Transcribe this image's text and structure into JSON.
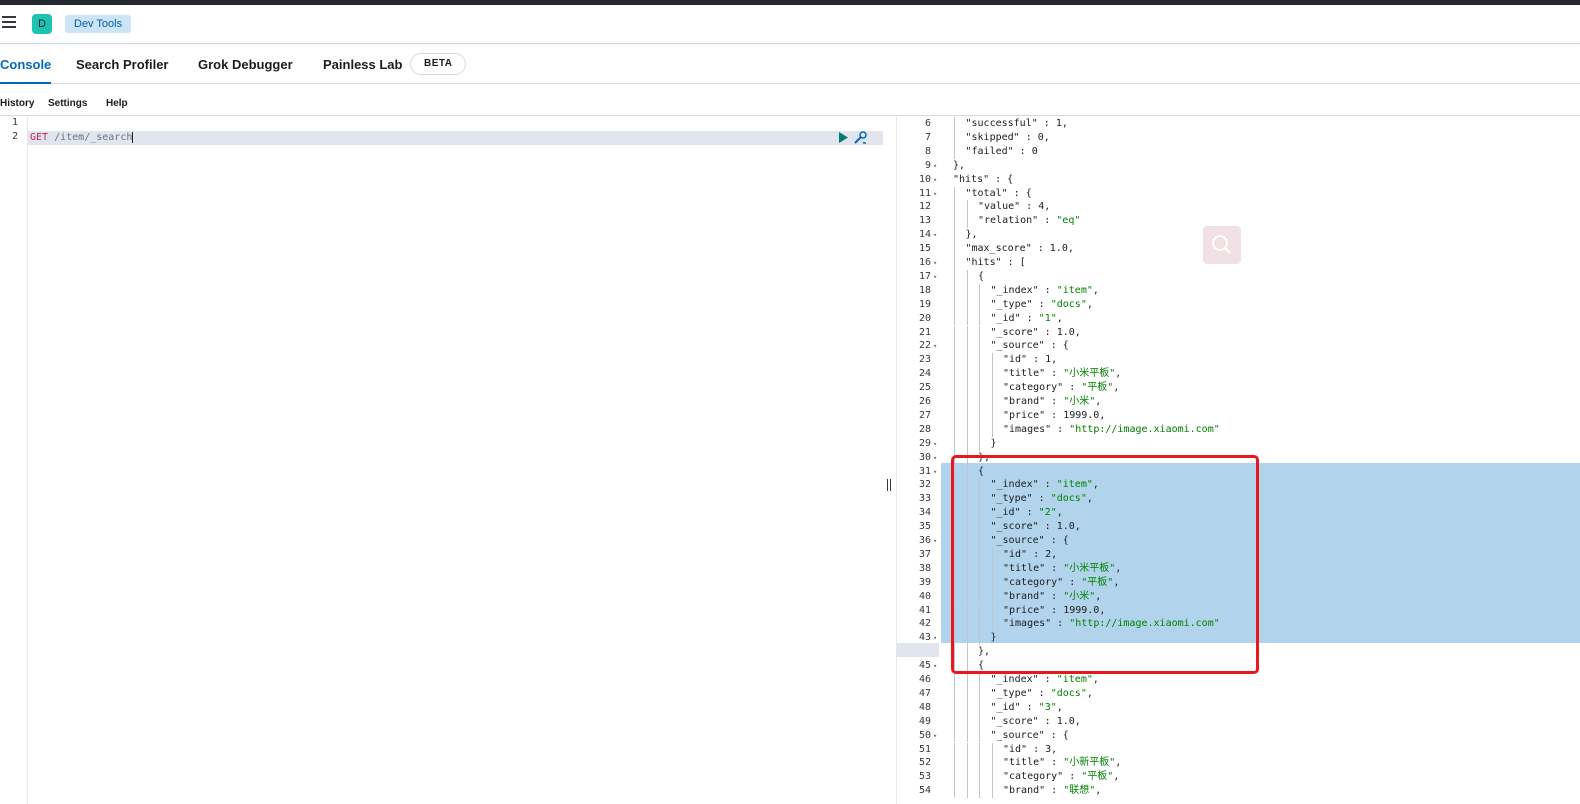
{
  "header": {
    "space_initial": "D",
    "breadcrumb": "Dev Tools"
  },
  "tabs": [
    {
      "label": "Console",
      "active": true
    },
    {
      "label": "Search Profiler",
      "active": false
    },
    {
      "label": "Grok Debugger",
      "active": false
    },
    {
      "label": "Painless Lab",
      "active": false
    }
  ],
  "beta_badge": "BETA",
  "subnav": {
    "history": "History",
    "settings": "Settings",
    "help": "Help"
  },
  "request": {
    "line_numbers": [
      "1",
      "2"
    ],
    "method": "GET",
    "path": "/item/_search"
  },
  "response": {
    "first_line_number": 6,
    "active_line_number": 44,
    "lines": [
      [
        2,
        [
          "k",
          "\"successful\" : "
        ],
        [
          "k",
          "1,"
        ]
      ],
      [
        2,
        [
          "k",
          "\"skipped\" : 0,"
        ]
      ],
      [
        2,
        [
          "k",
          "\"failed\" : 0"
        ]
      ],
      [
        1,
        [
          "k",
          "},"
        ]
      ],
      [
        1,
        [
          "k",
          "\"hits\" : {"
        ]
      ],
      [
        2,
        [
          "k",
          "\"total\" : {"
        ]
      ],
      [
        3,
        [
          "k",
          "\"value\" : 4,"
        ]
      ],
      [
        3,
        [
          "k",
          "\"relation\" : "
        ],
        [
          "s",
          "\"eq\""
        ]
      ],
      [
        2,
        [
          "k",
          "},"
        ]
      ],
      [
        2,
        [
          "k",
          "\"max_score\" : 1.0,"
        ]
      ],
      [
        2,
        [
          "k",
          "\"hits\" : ["
        ]
      ],
      [
        3,
        [
          "k",
          "{"
        ]
      ],
      [
        4,
        [
          "k",
          "\"_index\" : "
        ],
        [
          "s",
          "\"item\""
        ],
        [
          "k",
          ","
        ]
      ],
      [
        4,
        [
          "k",
          "\"_type\" : "
        ],
        [
          "s",
          "\"docs\""
        ],
        [
          "k",
          ","
        ]
      ],
      [
        4,
        [
          "k",
          "\"_id\" : "
        ],
        [
          "s",
          "\"1\""
        ],
        [
          "k",
          ","
        ]
      ],
      [
        4,
        [
          "k",
          "\"_score\" : 1.0,"
        ]
      ],
      [
        4,
        [
          "k",
          "\"_source\" : {"
        ]
      ],
      [
        5,
        [
          "k",
          "\"id\" : 1,"
        ]
      ],
      [
        5,
        [
          "k",
          "\"title\" : "
        ],
        [
          "s",
          "\"小米平板\""
        ],
        [
          "k",
          ","
        ]
      ],
      [
        5,
        [
          "k",
          "\"category\" : "
        ],
        [
          "s",
          "\"平板\""
        ],
        [
          "k",
          ","
        ]
      ],
      [
        5,
        [
          "k",
          "\"brand\" : "
        ],
        [
          "s",
          "\"小米\""
        ],
        [
          "k",
          ","
        ]
      ],
      [
        5,
        [
          "k",
          "\"price\" : 1999.0,"
        ]
      ],
      [
        5,
        [
          "k",
          "\"images\" : "
        ],
        [
          "s",
          "\"http://image.xiaomi.com\""
        ]
      ],
      [
        4,
        [
          "k",
          "}"
        ]
      ],
      [
        3,
        [
          "k",
          "},"
        ]
      ],
      [
        3,
        [
          "k",
          "{"
        ]
      ],
      [
        4,
        [
          "k",
          "\"_index\" : "
        ],
        [
          "s",
          "\"item\""
        ],
        [
          "k",
          ","
        ]
      ],
      [
        4,
        [
          "k",
          "\"_type\" : "
        ],
        [
          "s",
          "\"docs\""
        ],
        [
          "k",
          ","
        ]
      ],
      [
        4,
        [
          "k",
          "\"_id\" : "
        ],
        [
          "s",
          "\"2\""
        ],
        [
          "k",
          ","
        ]
      ],
      [
        4,
        [
          "k",
          "\"_score\" : 1.0,"
        ]
      ],
      [
        4,
        [
          "k",
          "\"_source\" : {"
        ]
      ],
      [
        5,
        [
          "k",
          "\"id\" : 2,"
        ]
      ],
      [
        5,
        [
          "k",
          "\"title\" : "
        ],
        [
          "s",
          "\"小米平板\""
        ],
        [
          "k",
          ","
        ]
      ],
      [
        5,
        [
          "k",
          "\"category\" : "
        ],
        [
          "s",
          "\"平板\""
        ],
        [
          "k",
          ","
        ]
      ],
      [
        5,
        [
          "k",
          "\"brand\" : "
        ],
        [
          "s",
          "\"小米\""
        ],
        [
          "k",
          ","
        ]
      ],
      [
        5,
        [
          "k",
          "\"price\" : 1999.0,"
        ]
      ],
      [
        5,
        [
          "k",
          "\"images\" : "
        ],
        [
          "s",
          "\"http://image.xiaomi.com\""
        ]
      ],
      [
        4,
        [
          "k",
          "}"
        ]
      ],
      [
        3,
        [
          "k",
          "},"
        ]
      ],
      [
        3,
        [
          "k",
          "{"
        ]
      ],
      [
        4,
        [
          "k",
          "\"_index\" : "
        ],
        [
          "s",
          "\"item\""
        ],
        [
          "k",
          ","
        ]
      ],
      [
        4,
        [
          "k",
          "\"_type\" : "
        ],
        [
          "s",
          "\"docs\""
        ],
        [
          "k",
          ","
        ]
      ],
      [
        4,
        [
          "k",
          "\"_id\" : "
        ],
        [
          "s",
          "\"3\""
        ],
        [
          "k",
          ","
        ]
      ],
      [
        4,
        [
          "k",
          "\"_score\" : 1.0,"
        ]
      ],
      [
        4,
        [
          "k",
          "\"_source\" : {"
        ]
      ],
      [
        5,
        [
          "k",
          "\"id\" : 3,"
        ]
      ],
      [
        5,
        [
          "k",
          "\"title\" : "
        ],
        [
          "s",
          "\"小新平板\""
        ],
        [
          "k",
          ","
        ]
      ],
      [
        5,
        [
          "k",
          "\"category\" : "
        ],
        [
          "s",
          "\"平板\""
        ],
        [
          "k",
          ","
        ]
      ],
      [
        5,
        [
          "k",
          "\"brand\" : "
        ],
        [
          "s",
          "\"联想\""
        ],
        [
          "k",
          ","
        ]
      ]
    ],
    "foldable_lines": [
      9,
      10,
      11,
      14,
      16,
      17,
      22,
      29,
      30,
      31,
      36,
      43,
      44,
      45,
      50
    ]
  },
  "colors": {
    "accent": "#006bb8",
    "string": "#008000",
    "selection": "#b1d4ec",
    "annotation_box": "#e8191c"
  }
}
